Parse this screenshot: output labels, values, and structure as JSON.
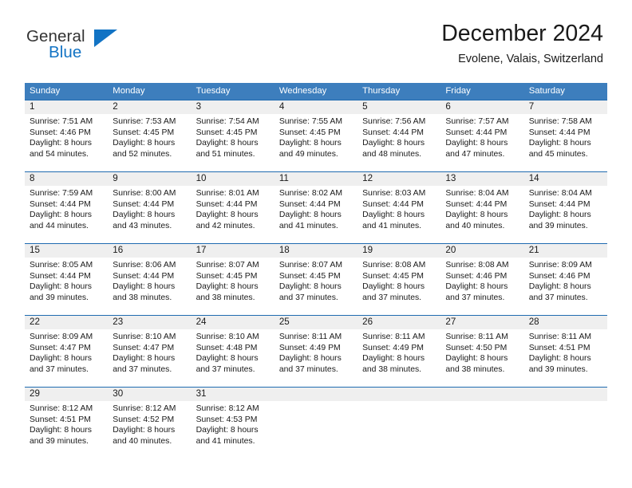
{
  "brand": {
    "name_part1": "General",
    "name_part2": "Blue",
    "logo_icon": "triangle-icon",
    "color_primary": "#1273c4",
    "color_text": "#333333"
  },
  "header": {
    "title": "December 2024",
    "location": "Evolene, Valais, Switzerland"
  },
  "calendar": {
    "header_bg": "#3d7ebd",
    "row_divider": "#1f6bb0",
    "daynum_band_bg": "#efefef",
    "weekdays": [
      "Sunday",
      "Monday",
      "Tuesday",
      "Wednesday",
      "Thursday",
      "Friday",
      "Saturday"
    ],
    "weeks": [
      [
        {
          "day": "1",
          "sunrise": "Sunrise: 7:51 AM",
          "sunset": "Sunset: 4:46 PM",
          "daylight_line1": "Daylight: 8 hours",
          "daylight_line2": "and 54 minutes."
        },
        {
          "day": "2",
          "sunrise": "Sunrise: 7:53 AM",
          "sunset": "Sunset: 4:45 PM",
          "daylight_line1": "Daylight: 8 hours",
          "daylight_line2": "and 52 minutes."
        },
        {
          "day": "3",
          "sunrise": "Sunrise: 7:54 AM",
          "sunset": "Sunset: 4:45 PM",
          "daylight_line1": "Daylight: 8 hours",
          "daylight_line2": "and 51 minutes."
        },
        {
          "day": "4",
          "sunrise": "Sunrise: 7:55 AM",
          "sunset": "Sunset: 4:45 PM",
          "daylight_line1": "Daylight: 8 hours",
          "daylight_line2": "and 49 minutes."
        },
        {
          "day": "5",
          "sunrise": "Sunrise: 7:56 AM",
          "sunset": "Sunset: 4:44 PM",
          "daylight_line1": "Daylight: 8 hours",
          "daylight_line2": "and 48 minutes."
        },
        {
          "day": "6",
          "sunrise": "Sunrise: 7:57 AM",
          "sunset": "Sunset: 4:44 PM",
          "daylight_line1": "Daylight: 8 hours",
          "daylight_line2": "and 47 minutes."
        },
        {
          "day": "7",
          "sunrise": "Sunrise: 7:58 AM",
          "sunset": "Sunset: 4:44 PM",
          "daylight_line1": "Daylight: 8 hours",
          "daylight_line2": "and 45 minutes."
        }
      ],
      [
        {
          "day": "8",
          "sunrise": "Sunrise: 7:59 AM",
          "sunset": "Sunset: 4:44 PM",
          "daylight_line1": "Daylight: 8 hours",
          "daylight_line2": "and 44 minutes."
        },
        {
          "day": "9",
          "sunrise": "Sunrise: 8:00 AM",
          "sunset": "Sunset: 4:44 PM",
          "daylight_line1": "Daylight: 8 hours",
          "daylight_line2": "and 43 minutes."
        },
        {
          "day": "10",
          "sunrise": "Sunrise: 8:01 AM",
          "sunset": "Sunset: 4:44 PM",
          "daylight_line1": "Daylight: 8 hours",
          "daylight_line2": "and 42 minutes."
        },
        {
          "day": "11",
          "sunrise": "Sunrise: 8:02 AM",
          "sunset": "Sunset: 4:44 PM",
          "daylight_line1": "Daylight: 8 hours",
          "daylight_line2": "and 41 minutes."
        },
        {
          "day": "12",
          "sunrise": "Sunrise: 8:03 AM",
          "sunset": "Sunset: 4:44 PM",
          "daylight_line1": "Daylight: 8 hours",
          "daylight_line2": "and 41 minutes."
        },
        {
          "day": "13",
          "sunrise": "Sunrise: 8:04 AM",
          "sunset": "Sunset: 4:44 PM",
          "daylight_line1": "Daylight: 8 hours",
          "daylight_line2": "and 40 minutes."
        },
        {
          "day": "14",
          "sunrise": "Sunrise: 8:04 AM",
          "sunset": "Sunset: 4:44 PM",
          "daylight_line1": "Daylight: 8 hours",
          "daylight_line2": "and 39 minutes."
        }
      ],
      [
        {
          "day": "15",
          "sunrise": "Sunrise: 8:05 AM",
          "sunset": "Sunset: 4:44 PM",
          "daylight_line1": "Daylight: 8 hours",
          "daylight_line2": "and 39 minutes."
        },
        {
          "day": "16",
          "sunrise": "Sunrise: 8:06 AM",
          "sunset": "Sunset: 4:44 PM",
          "daylight_line1": "Daylight: 8 hours",
          "daylight_line2": "and 38 minutes."
        },
        {
          "day": "17",
          "sunrise": "Sunrise: 8:07 AM",
          "sunset": "Sunset: 4:45 PM",
          "daylight_line1": "Daylight: 8 hours",
          "daylight_line2": "and 38 minutes."
        },
        {
          "day": "18",
          "sunrise": "Sunrise: 8:07 AM",
          "sunset": "Sunset: 4:45 PM",
          "daylight_line1": "Daylight: 8 hours",
          "daylight_line2": "and 37 minutes."
        },
        {
          "day": "19",
          "sunrise": "Sunrise: 8:08 AM",
          "sunset": "Sunset: 4:45 PM",
          "daylight_line1": "Daylight: 8 hours",
          "daylight_line2": "and 37 minutes."
        },
        {
          "day": "20",
          "sunrise": "Sunrise: 8:08 AM",
          "sunset": "Sunset: 4:46 PM",
          "daylight_line1": "Daylight: 8 hours",
          "daylight_line2": "and 37 minutes."
        },
        {
          "day": "21",
          "sunrise": "Sunrise: 8:09 AM",
          "sunset": "Sunset: 4:46 PM",
          "daylight_line1": "Daylight: 8 hours",
          "daylight_line2": "and 37 minutes."
        }
      ],
      [
        {
          "day": "22",
          "sunrise": "Sunrise: 8:09 AM",
          "sunset": "Sunset: 4:47 PM",
          "daylight_line1": "Daylight: 8 hours",
          "daylight_line2": "and 37 minutes."
        },
        {
          "day": "23",
          "sunrise": "Sunrise: 8:10 AM",
          "sunset": "Sunset: 4:47 PM",
          "daylight_line1": "Daylight: 8 hours",
          "daylight_line2": "and 37 minutes."
        },
        {
          "day": "24",
          "sunrise": "Sunrise: 8:10 AM",
          "sunset": "Sunset: 4:48 PM",
          "daylight_line1": "Daylight: 8 hours",
          "daylight_line2": "and 37 minutes."
        },
        {
          "day": "25",
          "sunrise": "Sunrise: 8:11 AM",
          "sunset": "Sunset: 4:49 PM",
          "daylight_line1": "Daylight: 8 hours",
          "daylight_line2": "and 37 minutes."
        },
        {
          "day": "26",
          "sunrise": "Sunrise: 8:11 AM",
          "sunset": "Sunset: 4:49 PM",
          "daylight_line1": "Daylight: 8 hours",
          "daylight_line2": "and 38 minutes."
        },
        {
          "day": "27",
          "sunrise": "Sunrise: 8:11 AM",
          "sunset": "Sunset: 4:50 PM",
          "daylight_line1": "Daylight: 8 hours",
          "daylight_line2": "and 38 minutes."
        },
        {
          "day": "28",
          "sunrise": "Sunrise: 8:11 AM",
          "sunset": "Sunset: 4:51 PM",
          "daylight_line1": "Daylight: 8 hours",
          "daylight_line2": "and 39 minutes."
        }
      ],
      [
        {
          "day": "29",
          "sunrise": "Sunrise: 8:12 AM",
          "sunset": "Sunset: 4:51 PM",
          "daylight_line1": "Daylight: 8 hours",
          "daylight_line2": "and 39 minutes."
        },
        {
          "day": "30",
          "sunrise": "Sunrise: 8:12 AM",
          "sunset": "Sunset: 4:52 PM",
          "daylight_line1": "Daylight: 8 hours",
          "daylight_line2": "and 40 minutes."
        },
        {
          "day": "31",
          "sunrise": "Sunrise: 8:12 AM",
          "sunset": "Sunset: 4:53 PM",
          "daylight_line1": "Daylight: 8 hours",
          "daylight_line2": "and 41 minutes."
        },
        {
          "day": "",
          "sunrise": "",
          "sunset": "",
          "daylight_line1": "",
          "daylight_line2": ""
        },
        {
          "day": "",
          "sunrise": "",
          "sunset": "",
          "daylight_line1": "",
          "daylight_line2": ""
        },
        {
          "day": "",
          "sunrise": "",
          "sunset": "",
          "daylight_line1": "",
          "daylight_line2": ""
        },
        {
          "day": "",
          "sunrise": "",
          "sunset": "",
          "daylight_line1": "",
          "daylight_line2": ""
        }
      ]
    ]
  }
}
